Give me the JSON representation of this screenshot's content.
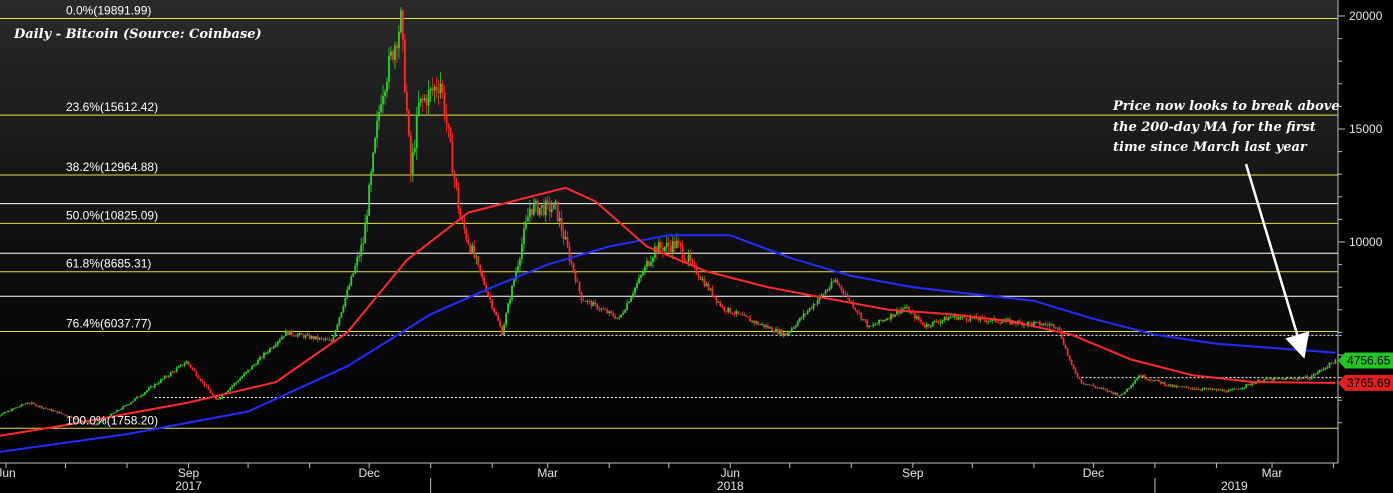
{
  "title": "Daily - Bitcoin (Source: Coinbase)",
  "annotation_lines": [
    "Price now looks to break above",
    "the 200-day MA for the first",
    "time since March last year"
  ],
  "colors": {
    "background": "#000000",
    "fib": "#e6df4a",
    "ma_fast": "#ff2a2a",
    "ma_slow": "#1f2fff",
    "up": "#2bd42b",
    "down": "#ff2a2a",
    "price_tag": "#22c522",
    "ma_tag": "#e02020"
  },
  "price_tags": {
    "price": "4756.65",
    "ma": "3765.69"
  },
  "chart_data": {
    "type": "line",
    "title": "Daily - Bitcoin (Source: Coinbase)",
    "xlabel": "",
    "ylabel": "",
    "ylim": [
      0,
      20300
    ],
    "y_ticks": [
      {
        "value": 20000,
        "label": "20000"
      },
      {
        "value": 15000,
        "label": "15000"
      },
      {
        "value": 10000,
        "label": "10000"
      }
    ],
    "x_month_ticks": [
      {
        "date": "2017-06-01",
        "label": "Jun"
      },
      {
        "date": "2017-09-01",
        "label": "Sep"
      },
      {
        "date": "2017-12-01",
        "label": "Dec"
      },
      {
        "date": "2018-03-01",
        "label": "Mar"
      },
      {
        "date": "2018-06-01",
        "label": "Jun"
      },
      {
        "date": "2018-09-01",
        "label": "Sep"
      },
      {
        "date": "2018-12-01",
        "label": "Dec"
      },
      {
        "date": "2019-03-01",
        "label": "Mar"
      }
    ],
    "x_year_labels": [
      {
        "date": "2017-09-01",
        "label": "2017"
      },
      {
        "date": "2018-06-01",
        "label": "2018"
      },
      {
        "date": "2019-02-10",
        "label": "2019"
      }
    ],
    "x_year_separators": [
      "2018-01-01",
      "2019-01-01"
    ],
    "fib_levels": [
      {
        "label": "0.0%(19891.99)",
        "value": 19891.99
      },
      {
        "label": "23.6%(15612.42)",
        "value": 15612.42
      },
      {
        "label": "38.2%(12964.88)",
        "value": 12964.88
      },
      {
        "label": "50.0%(10825.09)",
        "value": 10825.09
      },
      {
        "label": "61.8%(8685.31)",
        "value": 8685.31
      },
      {
        "label": "76.4%(6037.77)",
        "value": 6037.77
      },
      {
        "label": "100.0%(1758.20)",
        "value": 1758.2
      }
    ],
    "white_levels": [
      11700,
      9500,
      7600
    ],
    "support_levels_dashed": [
      {
        "value": 5870,
        "from": "2017-11-12",
        "to": "2019-04-05"
      },
      {
        "value": 4000,
        "from": "2018-11-25",
        "to": "2019-04-05"
      },
      {
        "value": 3120,
        "from": "2017-08-15",
        "to": "2019-04-05"
      }
    ],
    "series": [
      {
        "name": "Price",
        "points": [
          [
            "2017-05-20",
            2000
          ],
          [
            "2017-06-12",
            2900
          ],
          [
            "2017-07-16",
            1900
          ],
          [
            "2017-08-01",
            2800
          ],
          [
            "2017-08-31",
            4700
          ],
          [
            "2017-09-15",
            3000
          ],
          [
            "2017-10-01",
            4300
          ],
          [
            "2017-10-20",
            6000
          ],
          [
            "2017-11-12",
            5600
          ],
          [
            "2017-11-28",
            10000
          ],
          [
            "2017-12-07",
            16500
          ],
          [
            "2017-12-17",
            19800
          ],
          [
            "2017-12-22",
            13000
          ],
          [
            "2017-12-26",
            16000
          ],
          [
            "2018-01-06",
            17100
          ],
          [
            "2018-01-16",
            11000
          ],
          [
            "2018-02-06",
            6000
          ],
          [
            "2018-02-20",
            11500
          ],
          [
            "2018-03-05",
            11500
          ],
          [
            "2018-03-18",
            7500
          ],
          [
            "2018-04-06",
            6600
          ],
          [
            "2018-04-24",
            9700
          ],
          [
            "2018-05-05",
            9900
          ],
          [
            "2018-05-28",
            7100
          ],
          [
            "2018-06-12",
            6500
          ],
          [
            "2018-06-29",
            5900
          ],
          [
            "2018-07-24",
            8300
          ],
          [
            "2018-08-10",
            6200
          ],
          [
            "2018-08-28",
            7100
          ],
          [
            "2018-09-07",
            6300
          ],
          [
            "2018-09-21",
            6700
          ],
          [
            "2018-10-15",
            6500
          ],
          [
            "2018-11-13",
            6300
          ],
          [
            "2018-11-20",
            4500
          ],
          [
            "2018-11-25",
            3800
          ],
          [
            "2018-12-15",
            3200
          ],
          [
            "2018-12-24",
            4100
          ],
          [
            "2019-01-10",
            3600
          ],
          [
            "2019-02-08",
            3400
          ],
          [
            "2019-02-24",
            3900
          ],
          [
            "2019-03-20",
            4000
          ],
          [
            "2019-04-02",
            4756.65
          ]
        ]
      },
      {
        "name": "MA fast",
        "points": [
          [
            "2017-05-20",
            1300
          ],
          [
            "2017-07-01",
            1900
          ],
          [
            "2017-09-01",
            2900
          ],
          [
            "2017-10-15",
            3800
          ],
          [
            "2017-11-20",
            6000
          ],
          [
            "2017-12-20",
            9200
          ],
          [
            "2018-01-20",
            11300
          ],
          [
            "2018-02-20",
            12000
          ],
          [
            "2018-03-10",
            12400
          ],
          [
            "2018-03-25",
            11800
          ],
          [
            "2018-04-20",
            9800
          ],
          [
            "2018-05-20",
            8700
          ],
          [
            "2018-06-20",
            8000
          ],
          [
            "2018-07-20",
            7500
          ],
          [
            "2018-08-20",
            7000
          ],
          [
            "2018-09-20",
            6800
          ],
          [
            "2018-10-20",
            6500
          ],
          [
            "2018-11-20",
            5900
          ],
          [
            "2018-12-20",
            4800
          ],
          [
            "2019-01-20",
            4100
          ],
          [
            "2019-02-20",
            3800
          ],
          [
            "2019-04-02",
            3765.69
          ]
        ]
      },
      {
        "name": "MA slow",
        "points": [
          [
            "2017-05-20",
            600
          ],
          [
            "2017-08-01",
            1500
          ],
          [
            "2017-10-01",
            2500
          ],
          [
            "2017-11-20",
            4500
          ],
          [
            "2018-01-01",
            6800
          ],
          [
            "2018-02-01",
            8000
          ],
          [
            "2018-03-01",
            9000
          ],
          [
            "2018-04-01",
            9800
          ],
          [
            "2018-05-01",
            10300
          ],
          [
            "2018-06-01",
            10300
          ],
          [
            "2018-07-01",
            9300
          ],
          [
            "2018-08-01",
            8500
          ],
          [
            "2018-09-01",
            8000
          ],
          [
            "2018-10-01",
            7700
          ],
          [
            "2018-11-01",
            7400
          ],
          [
            "2018-12-01",
            6600
          ],
          [
            "2019-01-01",
            5900
          ],
          [
            "2019-02-01",
            5500
          ],
          [
            "2019-04-02",
            5100
          ]
        ]
      }
    ]
  }
}
